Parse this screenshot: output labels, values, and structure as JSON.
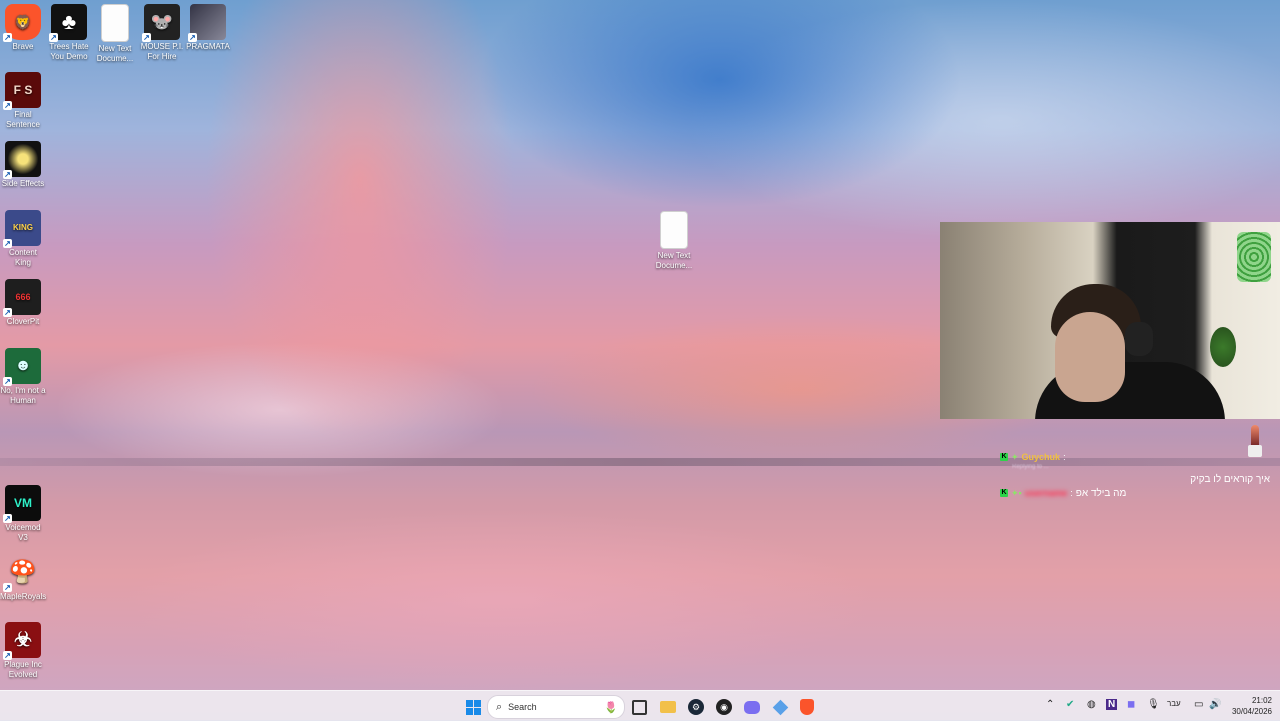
{
  "desktop": {
    "icons": [
      {
        "label": "Brave"
      },
      {
        "label": "Trees Hate You Demo"
      },
      {
        "label": "New Text Docume..."
      },
      {
        "label": "MOUSE P.I. For Hire"
      },
      {
        "label": "PRAGMATA"
      },
      {
        "label": "Final Sentence"
      },
      {
        "label": "Side Effects"
      },
      {
        "label": "Content King"
      },
      {
        "label": "CloverPit"
      },
      {
        "label": "No, I'm not a Human"
      },
      {
        "label": "Voicemod V3"
      },
      {
        "label": "MapleRoyals"
      },
      {
        "label": "Plague Inc Evolved"
      },
      {
        "label": "New Text Docume..."
      }
    ]
  },
  "chat": {
    "messages": [
      {
        "user": "Guychuk",
        "separator": ":",
        "reply_note": "Replying to ...",
        "text": "איך קוראים לו בקיק"
      },
      {
        "user": "username",
        "separator": ":",
        "text": "מה בילד אפ"
      }
    ]
  },
  "taskbar": {
    "search_placeholder": "Search",
    "tray_language": "עבר",
    "clock_time": "21:02",
    "clock_date": "30/04/2026"
  },
  "colors": {
    "taskbar_bg": "#eee9f0",
    "chat_name": "#f0c040",
    "kick_green": "#2dd34a"
  }
}
